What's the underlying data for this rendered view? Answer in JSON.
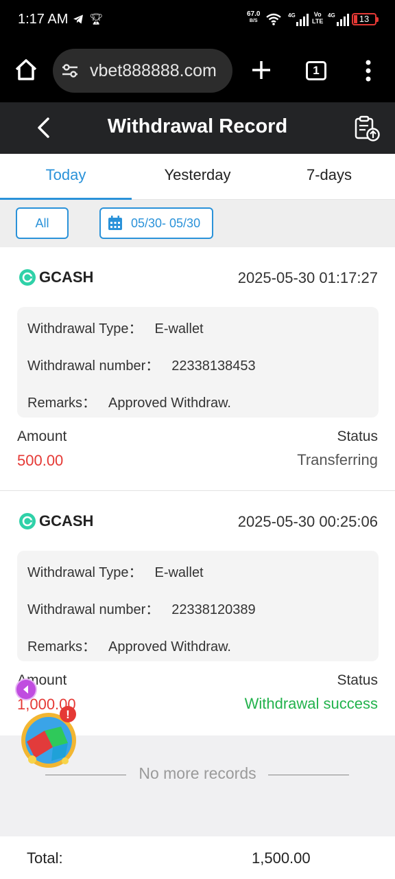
{
  "status_bar": {
    "time": "1:17 AM",
    "speed": "67.0",
    "speed_unit": "B/S",
    "net1": "4G",
    "volte_top": "Vo",
    "volte_bottom": "LTE",
    "net2": "4G",
    "battery": "13",
    "icons": [
      "telegram-icon",
      "trophy-icon",
      "wifi-icon",
      "signal-icon",
      "battery-icon"
    ]
  },
  "browser": {
    "url": "vbet888888.com",
    "tab_count": "1"
  },
  "header": {
    "title": "Withdrawal Record"
  },
  "tabs": [
    {
      "label": "Today",
      "active": true
    },
    {
      "label": "Yesterday",
      "active": false
    },
    {
      "label": "7-days",
      "active": false
    }
  ],
  "filters": {
    "all_label": "All",
    "date_range": "05/30- 05/30"
  },
  "records": [
    {
      "method": "GCASH",
      "time": "2025-05-30 01:17:27",
      "type_label": "Withdrawal Type：",
      "type_value": "E-wallet",
      "number_label": "Withdrawal number：",
      "number_value": "22338138453",
      "remarks_label": "Remarks：",
      "remarks_value": "Approved Withdraw.",
      "amount_label": "Amount",
      "amount_value": "500.00",
      "status_label": "Status",
      "status_value": "Transferring"
    },
    {
      "method": "GCASH",
      "time": "2025-05-30 00:25:06",
      "type_label": "Withdrawal Type：",
      "type_value": "E-wallet",
      "number_label": "Withdrawal number：",
      "number_value": "22338120389",
      "remarks_label": "Remarks：",
      "remarks_value": "Approved Withdraw.",
      "amount_label": "Amount",
      "amount_value": "1,000.00",
      "status_label": "Status",
      "status_value": "Withdrawal success"
    }
  ],
  "no_more": "No more records",
  "total": {
    "label": "Total:",
    "value": "1,500.00"
  },
  "colors": {
    "accent": "#2a92d9",
    "amount": "#e53935",
    "success": "#22b24c",
    "header_bg": "#232426"
  },
  "promo": {
    "badge": "!"
  }
}
